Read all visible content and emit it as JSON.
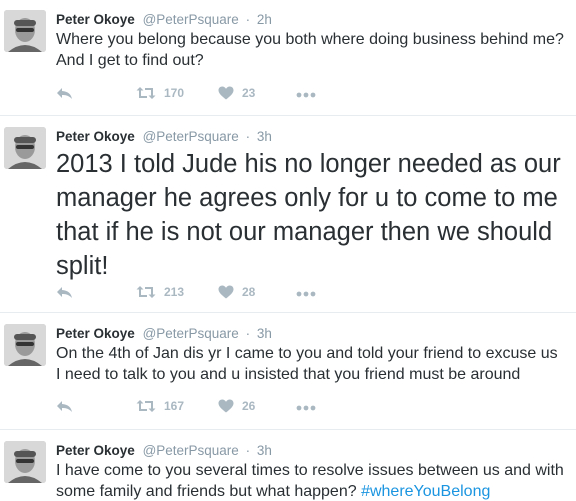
{
  "tweets": [
    {
      "name": "Peter Okoye",
      "handle": "@PeterPsquare",
      "separator": "·",
      "time": "2h",
      "text": "Where you belong because you both where doing business behind me? And I get to find out?",
      "retweets": "170",
      "likes": "23"
    },
    {
      "name": "Peter Okoye",
      "handle": "@PeterPsquare",
      "separator": "·",
      "time": "3h",
      "text": "2013 I told Jude his no longer needed as our manager he agrees only for u to come to me that if he is not our manager then we should split!",
      "retweets": "213",
      "likes": "28"
    },
    {
      "name": "Peter Okoye",
      "handle": "@PeterPsquare",
      "separator": "·",
      "time": "3h",
      "text": "On the 4th of Jan dis yr I came to you and told your friend to excuse us I need to talk to you and u insisted that you friend must be around",
      "retweets": "167",
      "likes": "26"
    },
    {
      "name": "Peter Okoye",
      "handle": "@PeterPsquare",
      "separator": "·",
      "time": "3h",
      "text": "I have come to you several times to resolve issues between us and with some family and friends but what happen?",
      "hashtag": "#whereYouBelong"
    }
  ],
  "icons": {
    "reply": "reply-icon",
    "retweet": "retweet-icon",
    "like": "heart-icon",
    "more": "more-dots-icon",
    "avatar": "avatar"
  },
  "colors": {
    "meta": "#8899a6",
    "link": "#1b95e0",
    "text": "#292f33",
    "divider": "#e6ecf0"
  }
}
